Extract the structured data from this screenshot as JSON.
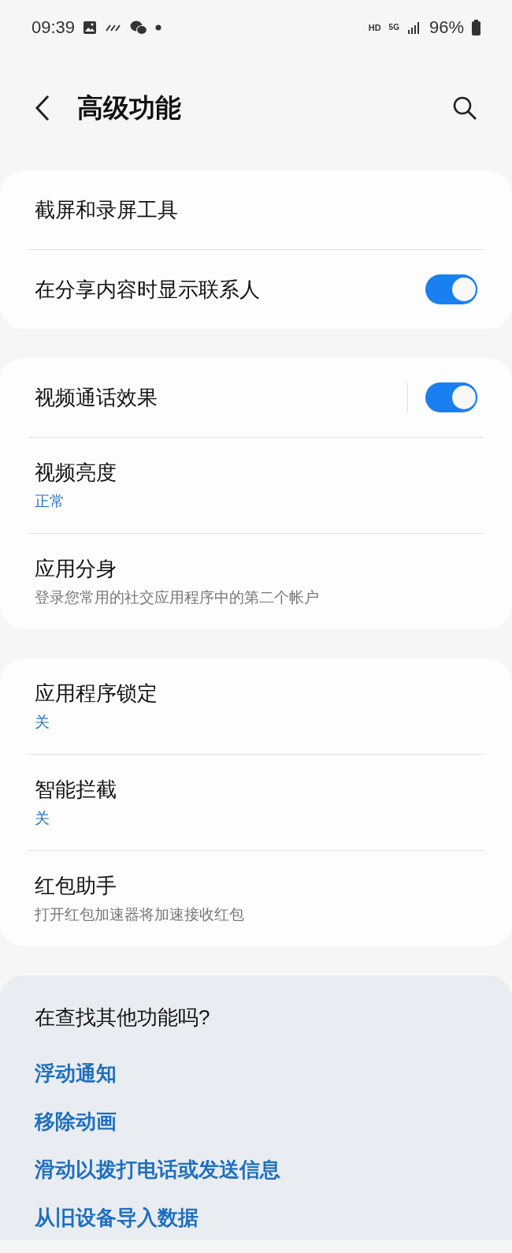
{
  "status_bar": {
    "time": "09:39",
    "hd": "HD",
    "network": "5G",
    "battery": "96%"
  },
  "header": {
    "title": "高级功能"
  },
  "groups": [
    {
      "items": [
        {
          "kind": "plain",
          "title": "截屏和录屏工具"
        },
        {
          "kind": "toggle",
          "title": "在分享内容时显示联系人",
          "on": true,
          "split": false
        }
      ]
    },
    {
      "items": [
        {
          "kind": "toggle",
          "title": "视频通话效果",
          "on": true,
          "split": true
        },
        {
          "kind": "value",
          "title": "视频亮度",
          "sub": "正常"
        },
        {
          "kind": "description",
          "title": "应用分身",
          "sub": "登录您常用的社交应用程序中的第二个帐户"
        }
      ]
    },
    {
      "items": [
        {
          "kind": "value",
          "title": "应用程序锁定",
          "sub": "关"
        },
        {
          "kind": "value",
          "title": "智能拦截",
          "sub": "关"
        },
        {
          "kind": "description",
          "title": "红包助手",
          "sub": "打开红包加速器将加速接收红包"
        }
      ]
    }
  ],
  "suggestions": {
    "title": "在查找其他功能吗?",
    "links": [
      "浮动通知",
      "移除动画",
      "滑动以拨打电话或发送信息",
      "从旧设备导入数据"
    ]
  }
}
